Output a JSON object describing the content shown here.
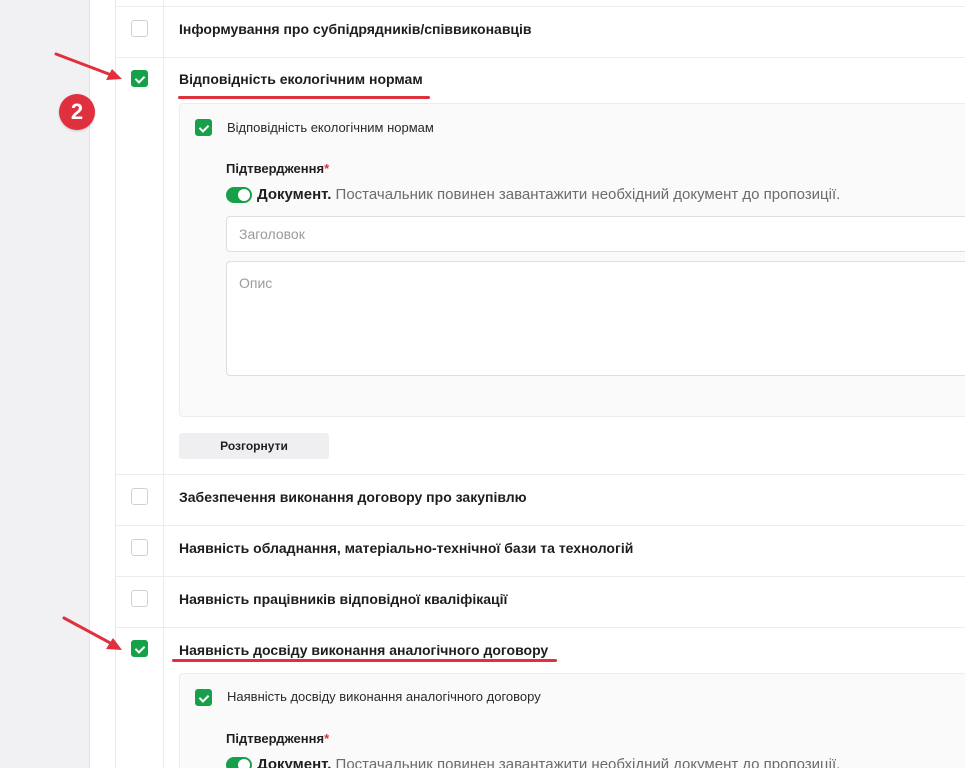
{
  "criteria": [
    {
      "label": "Інформування про субпідрядників/співвиконавців",
      "checked": false
    },
    {
      "label": "Відповідність екологічним нормам",
      "checked": true
    },
    {
      "label": "Забезпечення виконання договору про закупівлю",
      "checked": false
    },
    {
      "label": "Наявність обладнання, матеріально-технічної бази та технологій",
      "checked": false
    },
    {
      "label": "Наявність працівників відповідної кваліфікації",
      "checked": false
    },
    {
      "label": "Наявність досвіду виконання аналогічного договору",
      "checked": true
    }
  ],
  "panel1": {
    "title": "Відповідність екологічним нормам",
    "confirmation_label": "Підтвердження",
    "required_mark": "*",
    "doc_bold": "Документ.",
    "doc_text": " Постачальник повинен завантажити необхідний документ до пропозиції.",
    "title_placeholder": "Заголовок",
    "description_placeholder": "Опис",
    "expand_button": "Розгорнути"
  },
  "panel2": {
    "title": "Наявність досвіду виконання аналогічного договору",
    "confirmation_label": "Підтвердження",
    "required_mark": "*",
    "doc_bold": "Документ.",
    "doc_text": " Постачальник повинен завантажити необхідний документ до пропозиції."
  },
  "annotation": {
    "step_number": "2"
  },
  "colors": {
    "accent_green": "#16a04a",
    "annotation_red": "#e0303e"
  }
}
